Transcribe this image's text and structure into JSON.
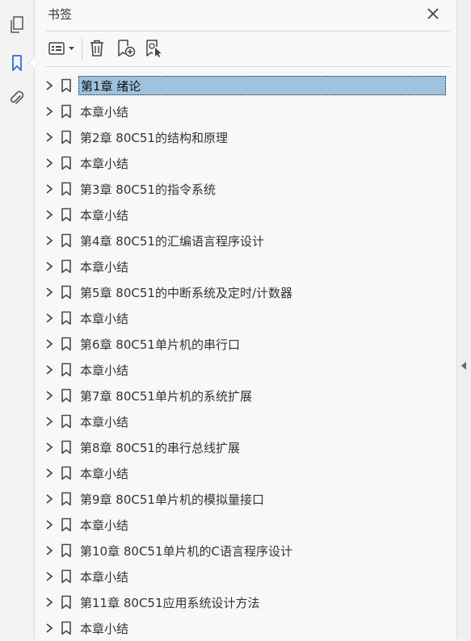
{
  "panel": {
    "title": "书签"
  },
  "rail": {
    "items": [
      "pages-icon",
      "bookmark-icon",
      "paperclip-icon"
    ],
    "active": "bookmark-icon"
  },
  "toolbar": {
    "tools": [
      "options-menu-icon",
      "delete-bookmark-icon",
      "new-bookmark-icon",
      "bookmark-from-selection-icon"
    ]
  },
  "bookmarks": [
    {
      "label": "第1章  绪论",
      "selected": true
    },
    {
      "label": "本章小结"
    },
    {
      "label": "第2章  80C51的结构和原理"
    },
    {
      "label": "本章小结"
    },
    {
      "label": "第3章  80C51的指令系统"
    },
    {
      "label": "本章小结"
    },
    {
      "label": "第4章  80C51的汇编语言程序设计"
    },
    {
      "label": "本章小结"
    },
    {
      "label": "第5章  80C51的中断系统及定时/计数器"
    },
    {
      "label": "本章小结"
    },
    {
      "label": "第6章  80C51单片机的串行口"
    },
    {
      "label": "本章小结"
    },
    {
      "label": "第7章  80C51单片机的系统扩展"
    },
    {
      "label": "本章小结"
    },
    {
      "label": "第8章  80C51的串行总线扩展"
    },
    {
      "label": "本章小结"
    },
    {
      "label": "第9章  80C51单片机的模拟量接口"
    },
    {
      "label": "本章小结"
    },
    {
      "label": "第10章  80C51单片机的C语言程序设计"
    },
    {
      "label": "本章小结"
    },
    {
      "label": "第11章  80C51应用系统设计方法"
    },
    {
      "label": "本章小结"
    }
  ],
  "colors": {
    "selection": "#9ec3e0",
    "icon": "#4a4a4a",
    "accent": "#2a6fd1"
  }
}
